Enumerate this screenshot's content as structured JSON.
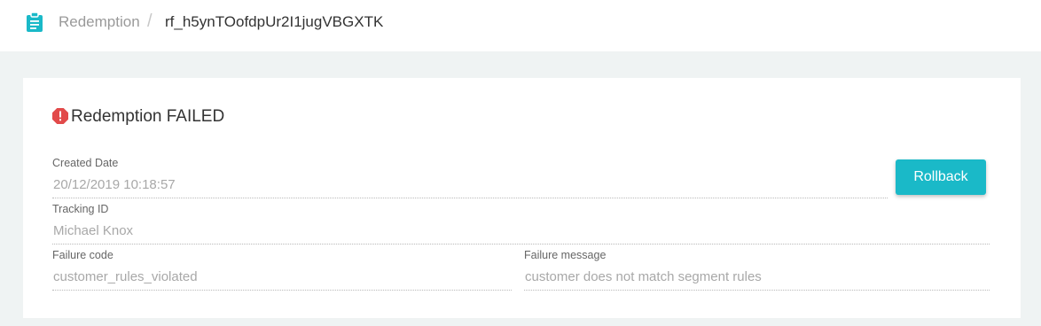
{
  "header": {
    "icon": "clipboard-icon",
    "breadcrumb_parent": "Redemption",
    "breadcrumb_separator": "/",
    "breadcrumb_current": "rf_h5ynTOofdpUr2I1jugVBGXTK",
    "icon_color": "#1ab9c8"
  },
  "status": {
    "icon": "error-octagon-icon",
    "title": "Redemption FAILED",
    "icon_color": "#e24a4a"
  },
  "fields": {
    "created_date_label": "Created Date",
    "created_date_value": "20/12/2019 10:18:57",
    "tracking_id_label": "Tracking ID",
    "tracking_id_value": "Michael Knox",
    "failure_code_label": "Failure code",
    "failure_code_value": "customer_rules_violated",
    "failure_message_label": "Failure message",
    "failure_message_value": "customer does not match segment rules"
  },
  "actions": {
    "rollback_label": "Rollback",
    "button_color": "#1ab9c8"
  }
}
